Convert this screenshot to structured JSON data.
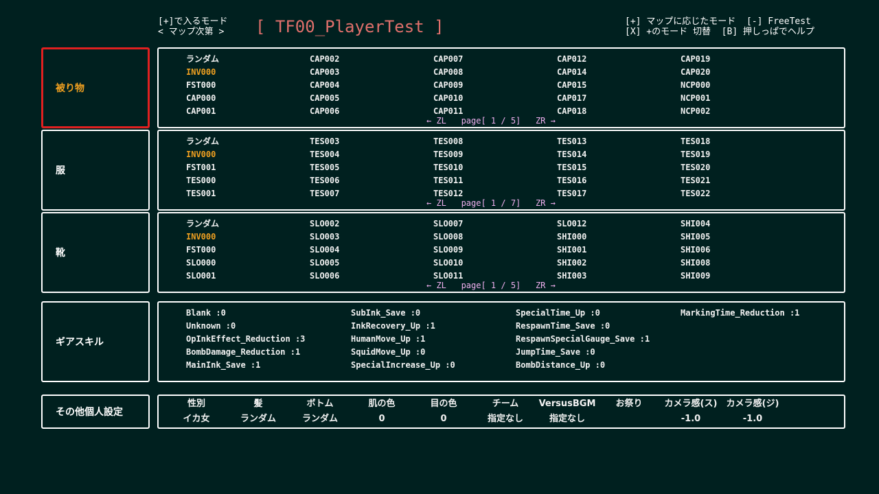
{
  "header": {
    "left_line1": "[+]で入るモード",
    "left_line2": "< マップ次第 >",
    "title": "[ TF00_PlayerTest ]",
    "right_line1": "[+] マップに応じたモード  [-] FreeTest",
    "right_line2": "[X] +のモード 切替  [B] 押しっぱでヘルプ"
  },
  "panels": [
    {
      "label": "被り物",
      "selected": true,
      "items": [
        "ランダム",
        "INV000",
        "FST000",
        "CAP000",
        "CAP001",
        "CAP002",
        "CAP003",
        "CAP004",
        "CAP005",
        "CAP006",
        "CAP007",
        "CAP008",
        "CAP009",
        "CAP010",
        "CAP011",
        "CAP012",
        "CAP014",
        "CAP015",
        "CAP017",
        "CAP018",
        "CAP019",
        "CAP020",
        "NCP000",
        "NCP001",
        "NCP002"
      ],
      "current_index": 1,
      "pager": "← ZL   page[ 1 / 5]   ZR →"
    },
    {
      "label": "服",
      "selected": false,
      "items": [
        "ランダム",
        "INV000",
        "FST001",
        "TES000",
        "TES001",
        "TES003",
        "TES004",
        "TES005",
        "TES006",
        "TES007",
        "TES008",
        "TES009",
        "TES010",
        "TES011",
        "TES012",
        "TES013",
        "TES014",
        "TES015",
        "TES016",
        "TES017",
        "TES018",
        "TES019",
        "TES020",
        "TES021",
        "TES022"
      ],
      "current_index": 1,
      "pager": "← ZL   page[ 1 / 7]   ZR →"
    },
    {
      "label": "靴",
      "selected": false,
      "items": [
        "ランダム",
        "INV000",
        "FST000",
        "SLO000",
        "SLO001",
        "SLO002",
        "SLO003",
        "SLO004",
        "SLO005",
        "SLO006",
        "SLO007",
        "SLO008",
        "SLO009",
        "SLO010",
        "SLO011",
        "SLO012",
        "SHI000",
        "SHI001",
        "SHI002",
        "SHI003",
        "SHI004",
        "SHI005",
        "SHI006",
        "SHI008",
        "SHI009"
      ],
      "current_index": 1,
      "pager": "← ZL   page[ 1 / 5]   ZR →"
    }
  ],
  "gear_skills": {
    "label": "ギアスキル",
    "items": [
      "Blank :0",
      "Unknown :0",
      "OpInkEffect_Reduction :3",
      "BombDamage_Reduction :1",
      "MainInk_Save :1",
      "SubInk_Save :0",
      "InkRecovery_Up :1",
      "HumanMove_Up :1",
      "SquidMove_Up :0",
      "SpecialIncrease_Up :0",
      "SpecialTime_Up :0",
      "RespawnTime_Save :0",
      "RespawnSpecialGauge_Save :1",
      "JumpTime_Save :0",
      "BombDistance_Up :0",
      "MarkingTime_Reduction :1"
    ]
  },
  "other_settings": {
    "label": "その他個人設定",
    "headers": [
      "性別",
      "髪",
      "ボトム",
      "肌の色",
      "目の色",
      "チーム",
      "VersusBGM",
      "お祭り",
      "カメラ感(ス)",
      "カメラ感(ジ)"
    ],
    "values": [
      "イカ女",
      "ランダム",
      "ランダム",
      "0",
      "0",
      "指定なし",
      "指定なし",
      "",
      "-1.0",
      "-1.0"
    ]
  },
  "colors": {
    "background": "#00201f",
    "accent_title": "#e0706c",
    "selected_border": "#e02020",
    "current_item": "#f0a020",
    "pager": "#f0b0f0"
  }
}
